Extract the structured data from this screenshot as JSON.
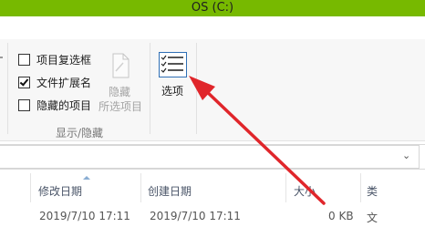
{
  "window": {
    "title": "OS (C:)"
  },
  "ribbon": {
    "show_hide_group": {
      "label": "显示/隐藏",
      "checkboxes": [
        {
          "label": "项目复选框",
          "checked": false
        },
        {
          "label": "文件扩展名",
          "checked": true
        },
        {
          "label": "隐藏的项目",
          "checked": false
        }
      ],
      "hide_selected": {
        "label_line1": "隐藏",
        "label_line2": "所选项目"
      }
    },
    "options_button": {
      "label": "选项",
      "icon": "options-checklist-icon"
    }
  },
  "address_bar": {
    "dropdown_icon": "chevron-down-icon"
  },
  "columns": {
    "date_modified": "修改日期",
    "date_created": "创建日期",
    "size": "大小",
    "type_partial": "类"
  },
  "rows": [
    {
      "date_modified": "2019/7/10 17:11",
      "date_created": "2019/7/10 17:11",
      "size": "0 KB",
      "type_partial": "文"
    }
  ],
  "colors": {
    "titlebar": "#77b900",
    "arrow": "#e0262b"
  }
}
